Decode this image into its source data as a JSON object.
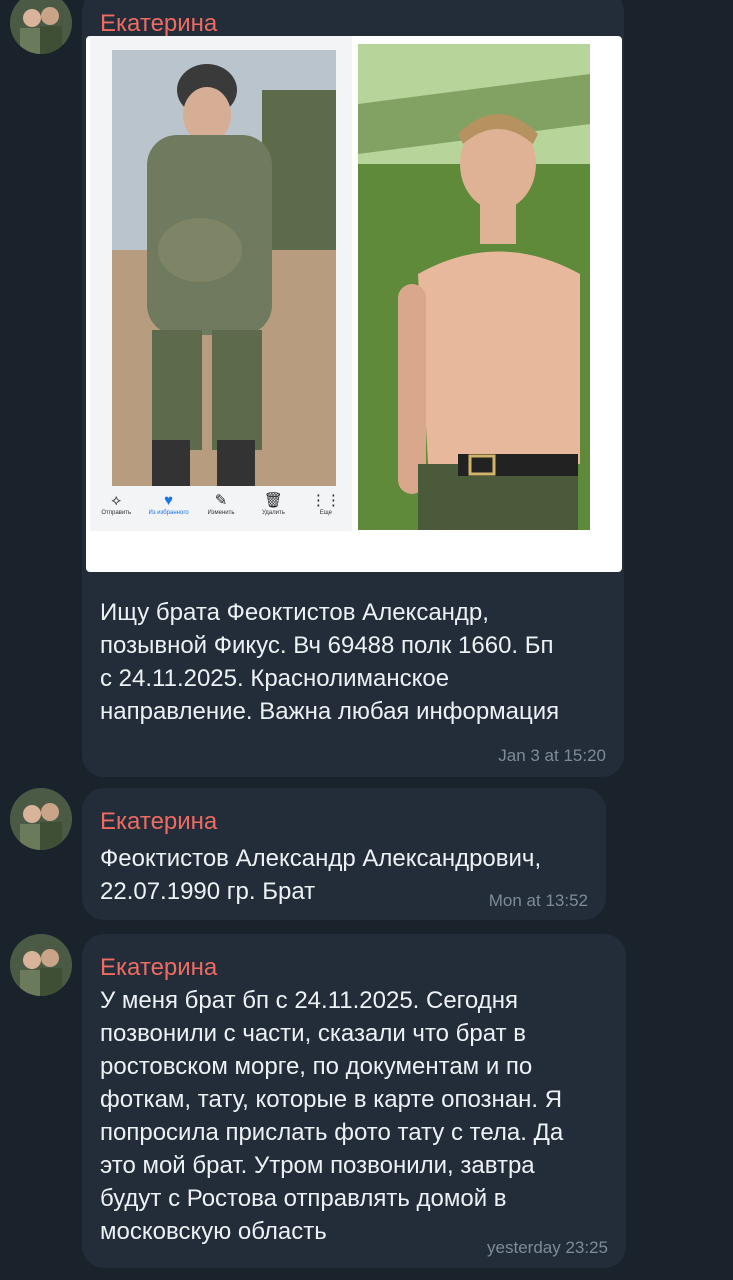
{
  "messages": [
    {
      "sender": "Екатерина",
      "text": "Ищу брата Феоктистов Александр,\nпозывной Фикус. Вч 69488 полк 1660. Бп\nс 24.11.2025. Краснолиманское\nнаправление. Важна любая информация",
      "time": "Jan 3 at 15:20",
      "photo_toolbar": [
        {
          "icon": "share-icon",
          "label": "Отправить"
        },
        {
          "icon": "heart-icon",
          "label": "Из избранного"
        },
        {
          "icon": "edit-icon",
          "label": "Изменить"
        },
        {
          "icon": "trash-icon",
          "label": "Удалить"
        },
        {
          "icon": "more-icon",
          "label": "Еще"
        }
      ]
    },
    {
      "sender": "Екатерина",
      "text": "Феоктистов Александр Александрович,\n22.07.1990 гр. Брат",
      "time": "Mon at 13:52"
    },
    {
      "sender": "Екатерина",
      "text": "У меня брат бп с 24.11.2025. Сегодня\nпозвонили с части, сказали что брат в\nростовском морге, по документам  и по\nфоткам, тату, которые в карте опознан. Я\nпопросила прислать фото тату с тела.  Да\nэто мой брат. Утром позвонили, завтра\nбудут с Ростова отправлять домой в\nмосковскую область",
      "time": "yesterday 23:25"
    }
  ],
  "colors": {
    "background": "#1a222c",
    "bubble": "#222d39",
    "sender": "#ee6b62",
    "text": "#eef1f4",
    "time": "#7f8b98"
  }
}
